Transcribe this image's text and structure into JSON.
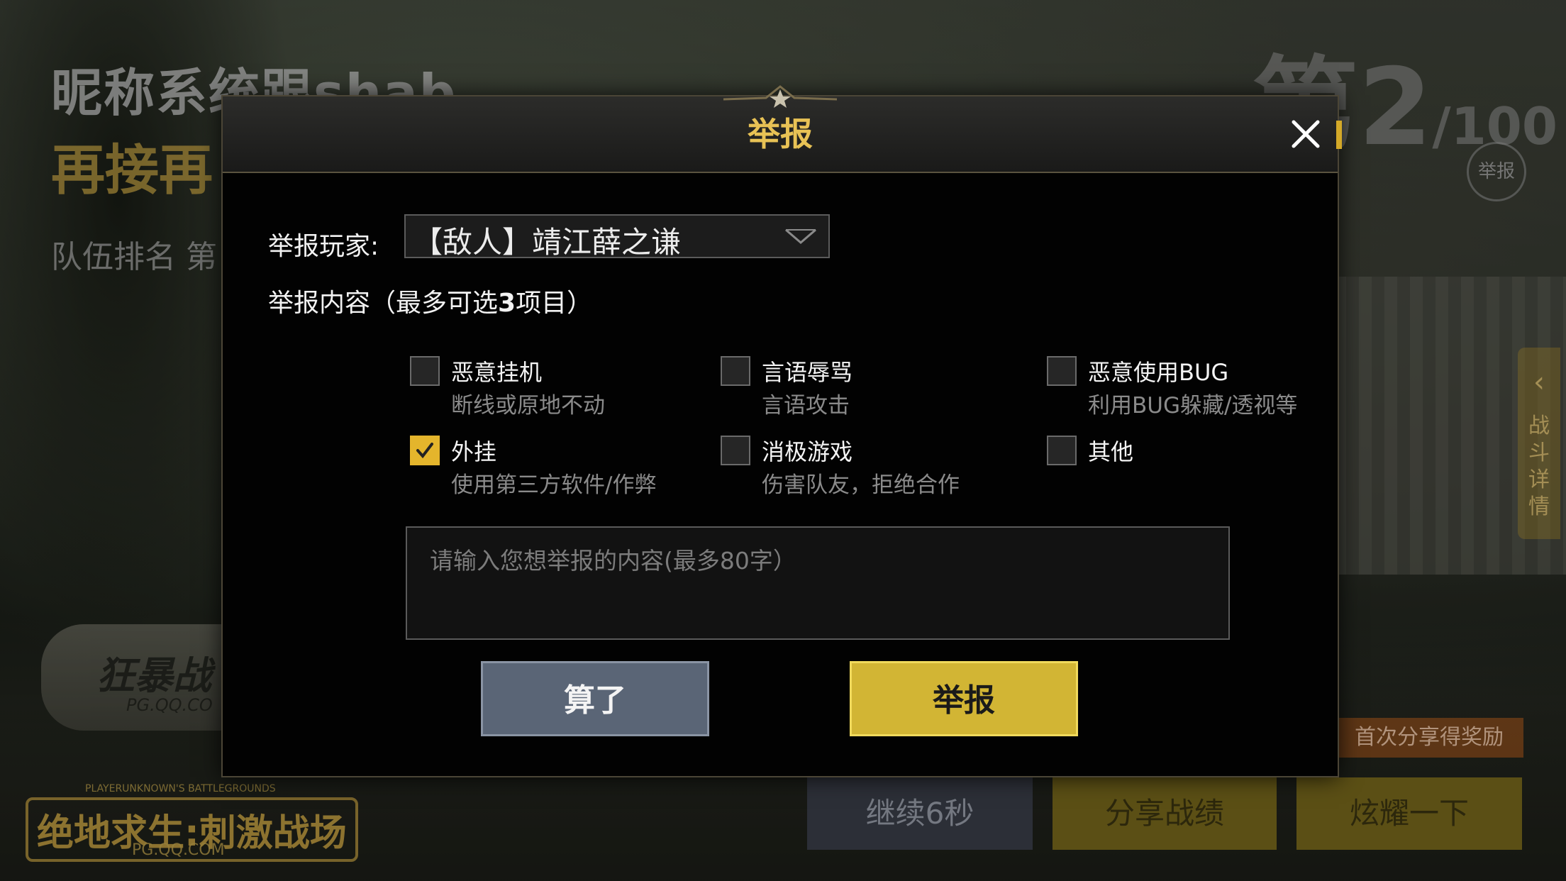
{
  "background": {
    "nickname_line": "昵称系统跟shab",
    "again_line": "再接再",
    "team_rank_line": "队伍排名 第",
    "rank_number": "第2",
    "rank_total": "/100",
    "report_circle_label": "举报",
    "side_tab_label": "战斗详情",
    "dogtag_text": "狂暴战",
    "dogtag_url": "PG.QQ.CO",
    "logo_subtitle": "PLAYERUNKNOWN'S BATTLEGROUNDS",
    "logo_text": "绝地求生:刺激战场",
    "logo_url": "PG.QQ.COM",
    "share_tip": "首次分享得奖励",
    "buttons": {
      "continue": "继续6秒",
      "share": "分享战绩",
      "show_off": "炫耀一下"
    }
  },
  "dialog": {
    "title": "举报",
    "player_label": "举报玩家:",
    "player_selected": "【敌人】靖江薛之谦",
    "content_label_prefix": "举报内容（最多可选",
    "content_label_count": "3",
    "content_label_suffix": "项目）",
    "options": [
      {
        "name": "恶意挂机",
        "desc": "断线或原地不动",
        "checked": false
      },
      {
        "name": "言语辱骂",
        "desc": "言语攻击",
        "checked": false
      },
      {
        "name": "恶意使用BUG",
        "desc": "利用BUG躲藏/透视等",
        "checked": false
      },
      {
        "name": "外挂",
        "desc": "使用第三方软件/作弊",
        "checked": true
      },
      {
        "name": "消极游戏",
        "desc": "伤害队友，拒绝合作",
        "checked": false
      },
      {
        "name": "其他",
        "desc": "",
        "checked": false
      }
    ],
    "input_placeholder": "请输入您想举报的内容(最多80字）",
    "input_value": "",
    "cancel_label": "算了",
    "submit_label": "举报"
  },
  "colors": {
    "accent_gold": "#e8c255",
    "checkbox_checked": "#e4b52c",
    "submit_button": "#d2b534",
    "cancel_button": "#5a6576"
  },
  "icons": {
    "close": "close-icon",
    "dropdown": "chevron-down-icon",
    "check": "checkmark-icon",
    "side_tab_arrow": "chevron-left-icon"
  }
}
